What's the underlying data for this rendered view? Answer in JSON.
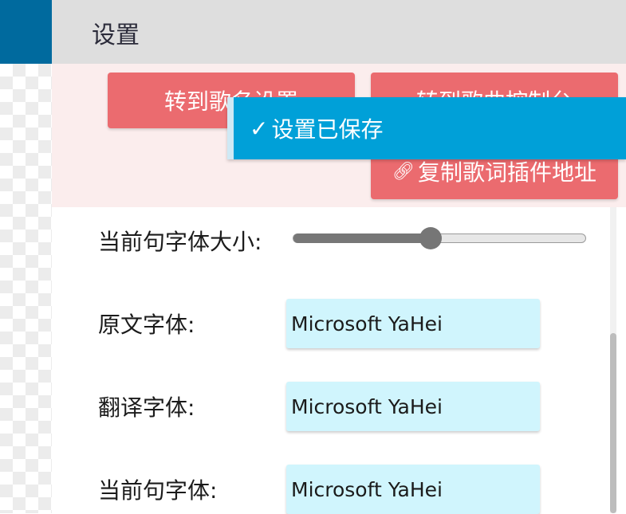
{
  "header": {
    "title": "设置"
  },
  "buttons": {
    "song_settings": "转到歌名设置",
    "song_console": "转到歌曲控制台",
    "copy_lyrics_url": "复制歌词插件地址",
    "copy_icon": "link-icon"
  },
  "toast": {
    "icon": "checkmark-icon",
    "message": "设置已保存"
  },
  "settings": {
    "current_line_size_label": "当前句字体大小:",
    "current_line_size_value": 0.47,
    "original_font_label": "原文字体:",
    "original_font_value": "Microsoft YaHei",
    "translation_font_label": "翻译字体:",
    "translation_font_value": "Microsoft YaHei",
    "current_line_font_label": "当前句字体:",
    "current_line_font_value": "Microsoft YaHei"
  },
  "colors": {
    "accent": "#006a9e",
    "button": "#eb6b6f",
    "toast": "#00a0d8",
    "input_bg": "#d0f5fd"
  }
}
